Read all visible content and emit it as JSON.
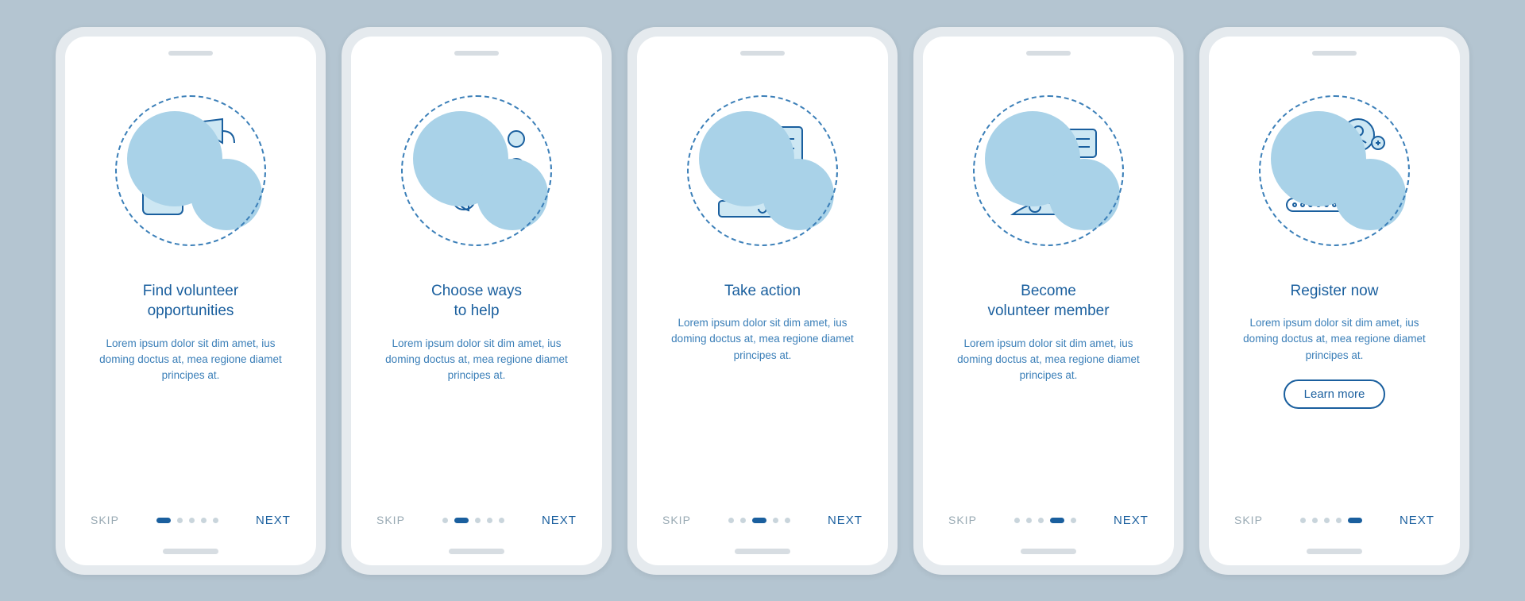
{
  "common": {
    "skip": "SKIP",
    "next": "NEXT",
    "desc": "Lorem ipsum dolor sit dim amet, ius doming doctus at, mea regione diamet principes at."
  },
  "screens": [
    {
      "title": "Find volunteer\nopportunities",
      "active": 0,
      "cta": null
    },
    {
      "title": "Choose ways\nto help",
      "active": 1,
      "cta": null
    },
    {
      "title": "Take action",
      "active": 2,
      "cta": null
    },
    {
      "title": "Become\nvolunteer member",
      "active": 3,
      "cta": null
    },
    {
      "title": "Register now",
      "active": 4,
      "cta": "Learn more"
    }
  ]
}
